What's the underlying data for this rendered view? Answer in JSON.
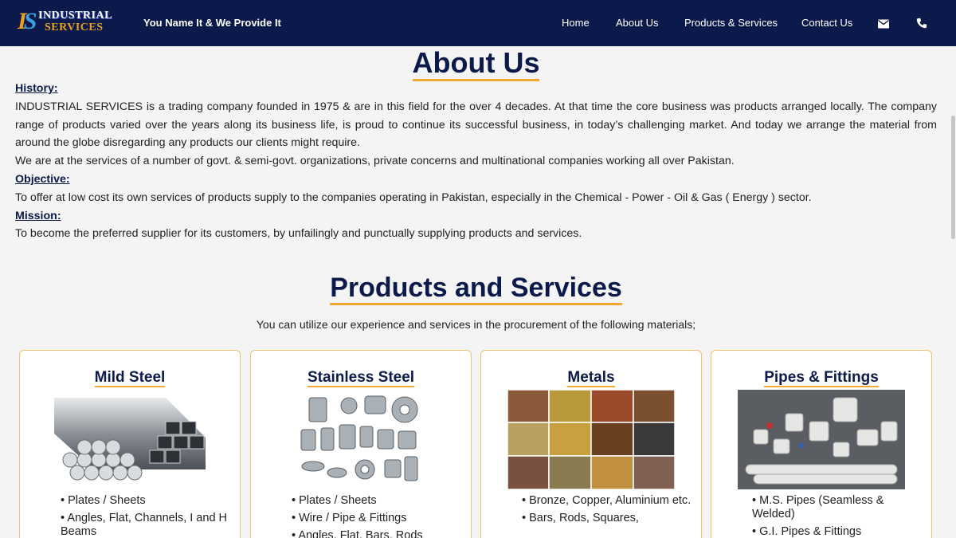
{
  "header": {
    "logo_line1": "INDUSTRIAL",
    "logo_line2": "SERVICES",
    "tagline": "You Name It & We Provide It",
    "nav": [
      "Home",
      "About Us",
      "Products & Services",
      "Contact Us"
    ],
    "icons": [
      "envelope-icon",
      "phone-icon"
    ]
  },
  "about": {
    "title": "About Us",
    "history_label": "History:",
    "history_p1": "INDUSTRIAL SERVICES is a trading company founded in 1975 & are in this field for the over 4 decades. At that time the core business was products arranged locally. The company range of products varied over the years along its business life, is proud to continue its successful business, in today’s challenging market. And today we arrange the material from around the globe disregarding any products our clients might require.",
    "history_p2": "We are at the services of a number of govt. & semi-govt. organizations, private concerns and multinational companies working all over Pakistan.",
    "objective_label": "Objective:",
    "objective_text": "To offer at low cost its own services of products supply to the companies operating in Pakistan, especially in the Chemical - Power - Oil & Gas ( Energy ) sector.",
    "mission_label": "Mission:",
    "mission_text": "To become the preferred supplier for its customers, by unfailingly and punctually supplying products and services."
  },
  "products": {
    "title": "Products and Services",
    "intro": "You can utilize our experience and services in the procurement of the following materials;",
    "cards": [
      {
        "title": "Mild Steel",
        "items": [
          "Plates / Sheets",
          "Angles, Flat, Channels, I and H Beams"
        ]
      },
      {
        "title": "Stainless Steel",
        "items": [
          "Plates / Sheets",
          "Wire / Pipe & Fittings",
          "Angles, Flat, Bars, Rods"
        ]
      },
      {
        "title": "Metals",
        "items": [
          "Bronze, Copper, Aluminium etc.",
          "Bars, Rods, Squares,"
        ]
      },
      {
        "title": "Pipes & Fittings",
        "items": [
          "M.S. Pipes (Seamless & Welded)",
          "G.I. Pipes & Fittings"
        ]
      }
    ]
  },
  "colors": {
    "navy": "#0b1a4a",
    "accent": "#f0a830"
  }
}
